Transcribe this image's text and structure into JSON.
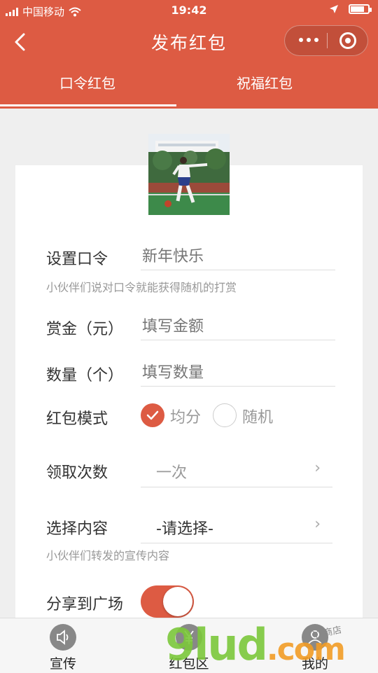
{
  "status": {
    "carrier": "中国移动",
    "time": "19:42",
    "battery_level": 0.85
  },
  "nav": {
    "title": "发布红包"
  },
  "tabs": [
    {
      "label": "口令红包",
      "active": true
    },
    {
      "label": "祝福红包",
      "active": false
    }
  ],
  "form": {
    "password_label": "设置口令",
    "password_placeholder": "新年快乐",
    "password_hint": "小伙伴们说对口令就能获得随机的打赏",
    "amount_label": "赏金（元）",
    "amount_placeholder": "填写金额",
    "count_label": "数量（个）",
    "count_placeholder": "填写数量",
    "mode_label": "红包模式",
    "mode_options": [
      {
        "label": "均分",
        "selected": true
      },
      {
        "label": "随机",
        "selected": false
      }
    ],
    "times_label": "领取次数",
    "times_value": "一次",
    "content_label": "选择内容",
    "content_value": "-请选择-",
    "content_hint": "小伙伴们转发的宣传内容",
    "share_label": "分享到广场",
    "share_on": true
  },
  "tabbar": [
    {
      "label": "宣传",
      "icon": "speaker-icon"
    },
    {
      "label": "红包区",
      "icon": "yuan-icon"
    },
    {
      "label": "我的",
      "icon": "user-icon"
    }
  ],
  "watermark": {
    "main": "9lud",
    "suffix": ".com",
    "small": "小丫 商店"
  },
  "colors": {
    "accent": "#dd5b43",
    "background": "#efefef"
  }
}
